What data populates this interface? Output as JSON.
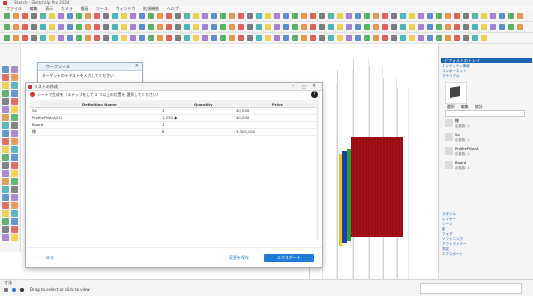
{
  "app": {
    "title": "Sketch - SketchUp Pro 2024",
    "menu": [
      "ファイル",
      "編集",
      "表示",
      "カメラ",
      "描画",
      "ツール",
      "ウィンドウ",
      "拡張機能",
      "ヘルプ"
    ]
  },
  "back_window": {
    "title": "ワークツール",
    "subtitle": "ターゲットのテキストを入力してください"
  },
  "dialog": {
    "title": "リストの作成",
    "instruction": "シートで生成を（ステップをして 2 つ以上の位置を 選択してください）",
    "columns": [
      "Definition Name",
      "Quantity",
      "Price"
    ],
    "rows": [
      {
        "name": "Sa",
        "quantity": "1",
        "price": "40,000"
      },
      {
        "name": "ProfilePillarA/(1)",
        "quantity": "1,230 ◆",
        "price": "40,000"
      },
      {
        "name": "Board",
        "quantity": "1",
        "price": ""
      },
      {
        "name": "棚",
        "quantity": "8",
        "price": "3,300,000"
      }
    ],
    "footer_left": "戻る",
    "cancel_label": "変更を保存",
    "export_label": "エクスポート"
  },
  "right_panel": {
    "tray_title": "デフォルトのトレイ",
    "sections": [
      "エンティティ情報",
      "コンポーネント",
      "マテリアル"
    ],
    "tabs": [
      "選択",
      "編集",
      "統計"
    ],
    "items": [
      {
        "name": "棚",
        "sub": "定義数: 1"
      },
      {
        "name": "Sa",
        "sub": "定義数: 1"
      },
      {
        "name": "ProfilePillarA",
        "sub": "定義数: 1"
      },
      {
        "name": "Board",
        "sub": "定義数: 1"
      }
    ],
    "bottom_sections": [
      "スタイル",
      "レイヤー",
      "シーン",
      "影",
      "フォグ",
      "ソフトニング",
      "アウトライナー",
      "測定",
      "エクスポート"
    ]
  },
  "status": {
    "measure_label": "寸法",
    "hint": "Drag to select or click to view"
  },
  "colors": {
    "accent": "#1f7bd8",
    "panel_title": "#1f66b0",
    "model_red": "#b3121b",
    "model_blue": "#1a3fb4",
    "model_green": "#2a9a3a",
    "model_yellow": "#f2c318"
  }
}
